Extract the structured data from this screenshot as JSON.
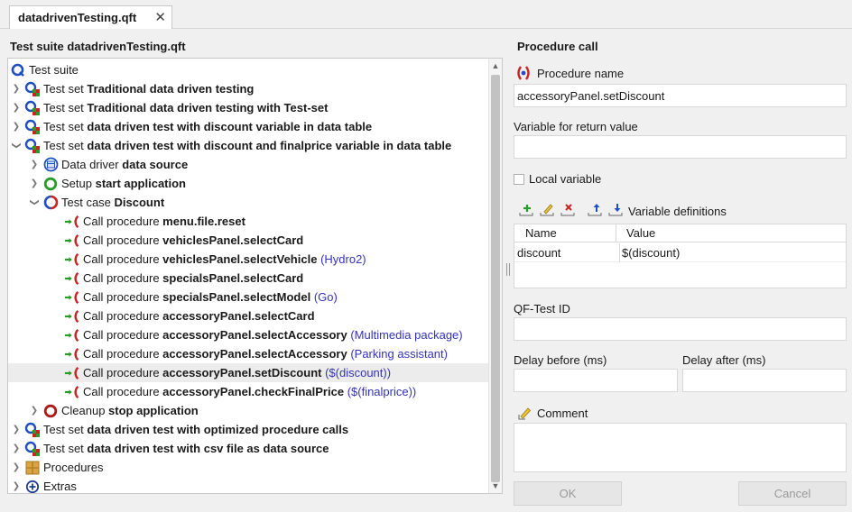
{
  "tab": {
    "title": "datadrivenTesting.qft",
    "close": "✕"
  },
  "tree": {
    "title": "Test suite datadrivenTesting.qft",
    "nodes": [
      {
        "prefix": "Test suite",
        "name": "",
        "param": ""
      },
      {
        "prefix": "Test set ",
        "name": "Traditional data driven testing",
        "param": ""
      },
      {
        "prefix": "Test set ",
        "name": "Traditional data driven testing with Test-set",
        "param": ""
      },
      {
        "prefix": "Test set ",
        "name": "data driven test with discount variable in data table",
        "param": ""
      },
      {
        "prefix": "Test set ",
        "name": "data driven test with discount and finalprice variable in data table",
        "param": ""
      },
      {
        "prefix": "Data driver ",
        "name": "data source",
        "param": ""
      },
      {
        "prefix": "Setup ",
        "name": "start application",
        "param": ""
      },
      {
        "prefix": "Test case ",
        "name": "Discount",
        "param": ""
      },
      {
        "prefix": "Call procedure ",
        "name": "menu.file.reset",
        "param": ""
      },
      {
        "prefix": "Call procedure ",
        "name": "vehiclesPanel.selectCard",
        "param": ""
      },
      {
        "prefix": "Call procedure ",
        "name": "vehiclesPanel.selectVehicle",
        "param": "(Hydro2)"
      },
      {
        "prefix": "Call procedure ",
        "name": "specialsPanel.selectCard",
        "param": ""
      },
      {
        "prefix": "Call procedure ",
        "name": "specialsPanel.selectModel",
        "param": "(Go)"
      },
      {
        "prefix": "Call procedure ",
        "name": "accessoryPanel.selectCard",
        "param": ""
      },
      {
        "prefix": "Call procedure ",
        "name": "accessoryPanel.selectAccessory",
        "param": "(Multimedia package)"
      },
      {
        "prefix": "Call procedure ",
        "name": "accessoryPanel.selectAccessory",
        "param": "(Parking assistant)"
      },
      {
        "prefix": "Call procedure ",
        "name": "accessoryPanel.setDiscount",
        "param": "($(discount))"
      },
      {
        "prefix": "Call procedure ",
        "name": "accessoryPanel.checkFinalPrice",
        "param": "($(finalprice))"
      },
      {
        "prefix": "Cleanup ",
        "name": "stop application",
        "param": ""
      },
      {
        "prefix": "Test set ",
        "name": "data driven test with optimized procedure calls",
        "param": ""
      },
      {
        "prefix": "Test set ",
        "name": "data driven test with csv file as data source",
        "param": ""
      },
      {
        "prefix": "Procedures",
        "name": "",
        "param": ""
      },
      {
        "prefix": "Extras",
        "name": "",
        "param": ""
      }
    ]
  },
  "details": {
    "title": "Procedure call",
    "procedure_name_label": "Procedure name",
    "procedure_name_value": "accessoryPanel.setDiscount",
    "return_label": "Variable for return value",
    "return_value": "",
    "local_variable_label": "Local variable",
    "local_variable_checked": false,
    "var_defs_label": "Variable definitions",
    "table": {
      "headers": [
        "Name",
        "Value"
      ],
      "rows": [
        {
          "name": "discount",
          "value": "$(discount)"
        }
      ]
    },
    "qftest_id_label": "QF-Test ID",
    "qftest_id_value": "",
    "delay_before_label": "Delay before (ms)",
    "delay_before_value": "",
    "delay_after_label": "Delay after (ms)",
    "delay_after_value": "",
    "comment_label": "Comment",
    "comment_value": "",
    "ok_label": "OK",
    "cancel_label": "Cancel"
  },
  "colors": {
    "param_text": "#3333bb",
    "selected_row": "#ececec",
    "procedure_red": "#cc2222",
    "call_green": "#2a9a2a",
    "testset_blue": "#1f4fbf"
  }
}
